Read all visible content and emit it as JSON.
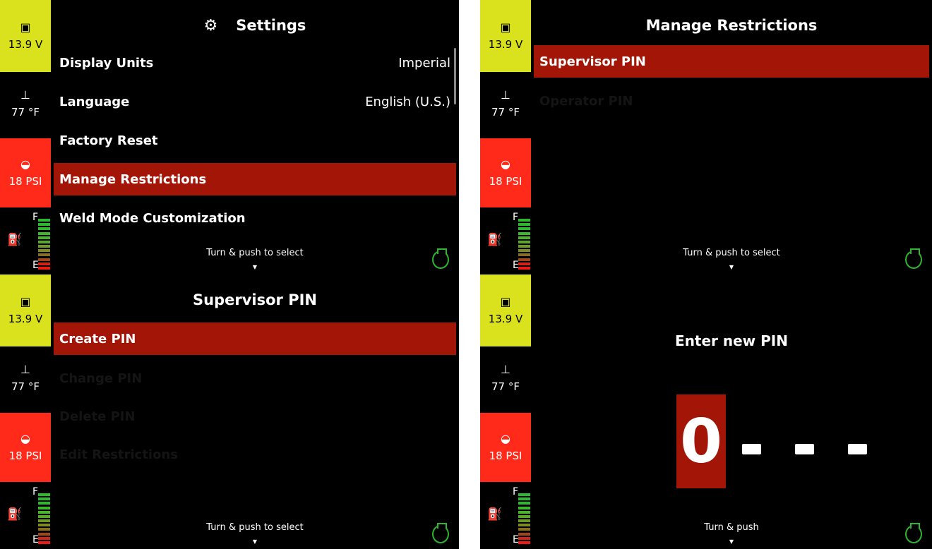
{
  "status": {
    "battery": "13.9 V",
    "temperature": "77 °F",
    "oil_pressure": "18 PSI",
    "fuel_full": "F",
    "fuel_empty": "E",
    "fuel_level": 0.8,
    "battery_color": "#d9e21c",
    "oil_color": "#ff2a1a"
  },
  "icons": {
    "battery": "battery-icon",
    "temperature": "coolant-temp-icon",
    "oil": "oil-can-icon",
    "fuel": "fuel-pump-icon",
    "settings": "gear-icon",
    "knob": "control-knob-icon"
  },
  "screen1": {
    "title": "Settings",
    "items": [
      {
        "label": "Display Units",
        "value": "Imperial"
      },
      {
        "label": "Language",
        "value": "English (U.S.)"
      },
      {
        "label": "Factory Reset",
        "value": ""
      },
      {
        "label": "Manage Restrictions",
        "value": ""
      },
      {
        "label": "Weld Mode Customization",
        "value": ""
      }
    ],
    "selected_index": 3,
    "hint": "Turn & push to select"
  },
  "screen2": {
    "title": "Manage Restrictions",
    "items": [
      {
        "label": "Supervisor PIN"
      },
      {
        "label": "Operator PIN"
      }
    ],
    "hint": "Turn & push to select"
  },
  "screen3": {
    "title": "Supervisor PIN",
    "items": [
      {
        "label": "Create PIN"
      },
      {
        "label": "Change PIN"
      },
      {
        "label": "Delete PIN"
      },
      {
        "label": "Edit Restrictions"
      }
    ],
    "hint": "Turn & push to select"
  },
  "screen4": {
    "title": "Enter new PIN",
    "digit": "0",
    "hint": "Turn & push"
  },
  "accent_color": "#a31507"
}
